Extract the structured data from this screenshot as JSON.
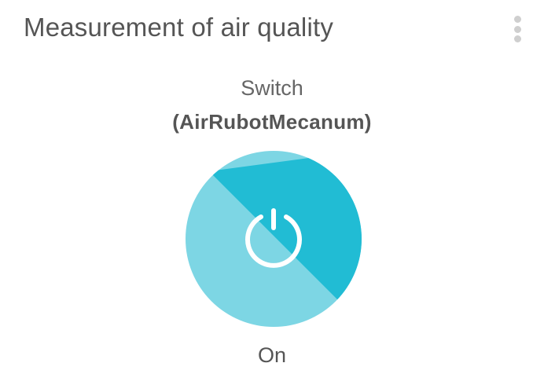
{
  "card": {
    "title": "Measurement of air quality",
    "menu_icon": "more-vertical-icon"
  },
  "switch": {
    "label": "Switch",
    "device": "(AirRubotMecanum)",
    "state": "On",
    "icon": "power-icon",
    "colors": {
      "active": "#21bcd4",
      "light": "#7dd6e4",
      "icon": "#ffffff"
    }
  }
}
